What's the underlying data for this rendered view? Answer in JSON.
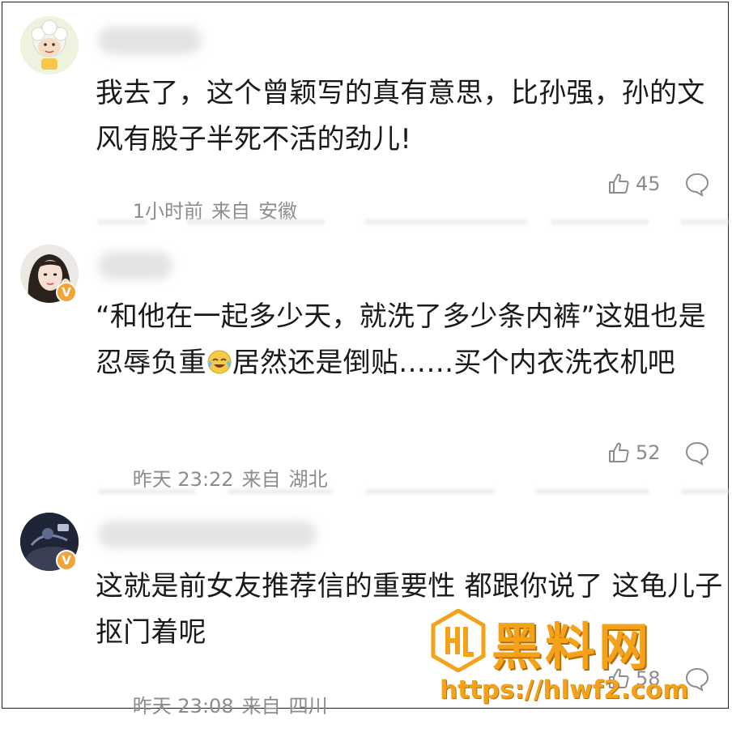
{
  "comments": [
    {
      "text": "我去了，这个曾颖写的真有意思，比孙强，孙的文风有股子半死不活的劲儿!",
      "time": "1小时前",
      "from_label": "来自",
      "location": "安徽",
      "likes": "45",
      "verified": false
    },
    {
      "text_before_emoji": "“和他在一起多少天，就洗了多少条内裤”这姐也是忍辱负重",
      "text_after_emoji": "居然还是倒贴……买个内衣洗衣机吧",
      "emoji": "laugh-cry-emoji",
      "time": "昨天 23:22",
      "from_label": "来自",
      "location": "湖北",
      "likes": "52",
      "verified": true,
      "verified_mark": "V"
    },
    {
      "text": "这就是前女友推荐信的重要性 都跟你说了 这龟儿子抠门着呢",
      "time": "昨天 23:08",
      "from_label": "来自",
      "location": "四川",
      "likes": "58",
      "verified": true,
      "verified_mark": "V"
    }
  ],
  "watermark": {
    "title": "黑料网",
    "url": "https://hlwf2.com",
    "color": "#f5a21b"
  },
  "icons": {
    "like": "thumbs-up-icon",
    "reply": "comment-bubble-icon"
  }
}
